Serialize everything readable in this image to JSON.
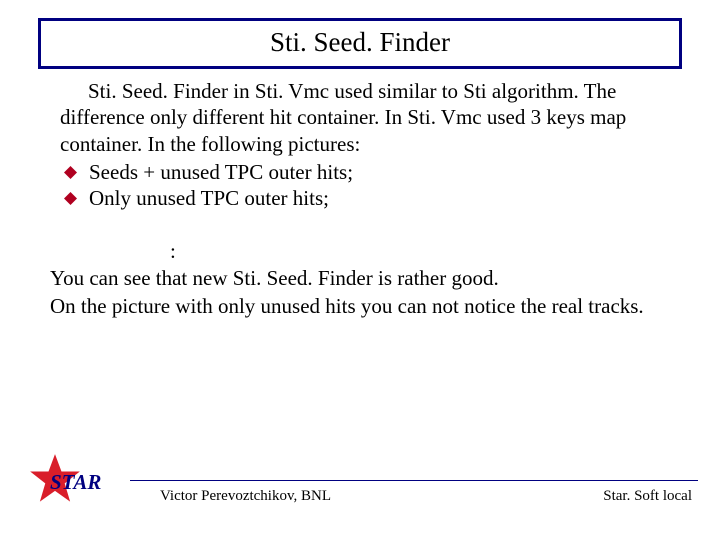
{
  "title": "Sti. Seed. Finder",
  "body": {
    "para1": "Sti. Seed. Finder in Sti. Vmc used similar to Sti algorithm. The difference only different hit container. In Sti. Vmc used 3 keys map container. In the following pictures:",
    "bullets": [
      "Seeds + unused TPC outer hits;",
      "Only unused TPC outer hits;"
    ]
  },
  "lower": {
    "line1": ":",
    "line2": "You can see that new Sti. Seed. Finder is rather good.",
    "line3": "On the picture with only unused hits you can not notice the real tracks."
  },
  "footer": {
    "logo_label": "STAR",
    "center": "Victor Perevoztchikov, BNL",
    "right": "Star. Soft local"
  },
  "colors": {
    "navy": "#000080",
    "bullet": "#b00020"
  }
}
